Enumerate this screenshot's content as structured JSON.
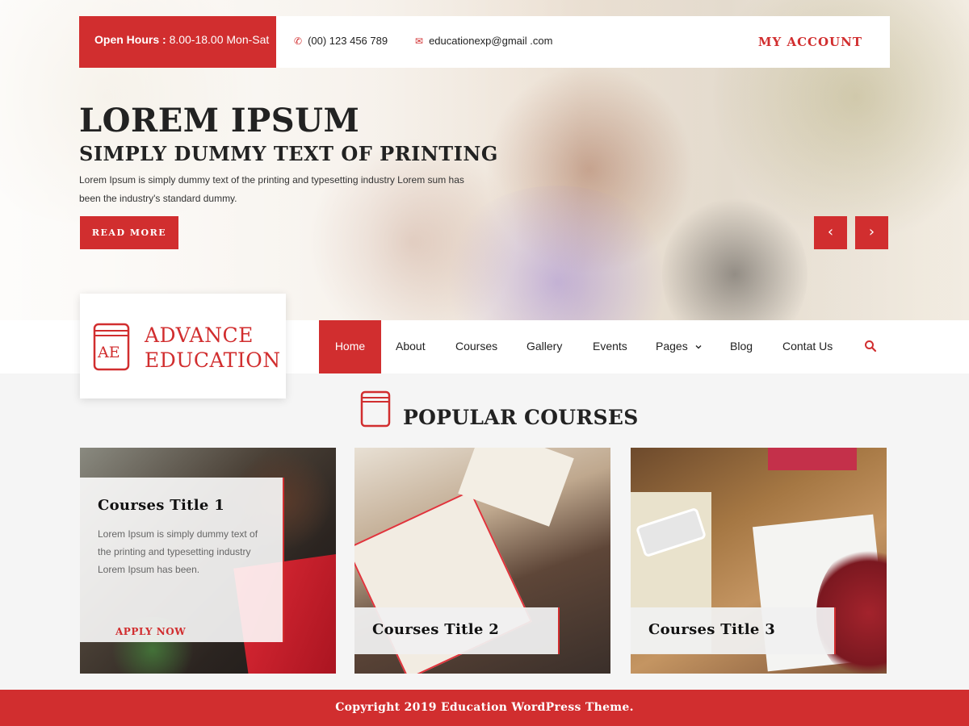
{
  "colors": {
    "accent": "#d12e2f",
    "nav_bg": "#ffffff",
    "page_bg": "#f5f5f5"
  },
  "topbar": {
    "open_hours_label": "Open Hours :",
    "open_hours_value": "8.00-18.00 Mon-Sat",
    "phone": "(00) 123 456 789",
    "phone_icon": "phone-icon",
    "email": "educationexp@gmail .com",
    "email_icon": "envelope-icon",
    "my_account": "MY ACCOUNT"
  },
  "slider": {
    "title": "LOREM IPSUM",
    "subtitle": "SIMPLY DUMMY TEXT OF PRINTING",
    "text": "Lorem Ipsum is simply dummy text of the printing and typesetting industry Lorem sum has been the industry's standard dummy.",
    "button": "READ MORE",
    "prev_icon": "chevron-left-icon",
    "next_icon": "chevron-right-icon"
  },
  "logo": {
    "icon_text": "AE",
    "line1": "ADVANCE",
    "line2": "EDUCATION"
  },
  "nav": {
    "items": [
      {
        "label": "Home",
        "active": true
      },
      {
        "label": "About"
      },
      {
        "label": "Courses"
      },
      {
        "label": "Gallery"
      },
      {
        "label": "Events"
      },
      {
        "label": "Pages",
        "dropdown": true
      },
      {
        "label": "Blog"
      },
      {
        "label": "Contat Us"
      }
    ],
    "search_icon": "search-icon"
  },
  "section": {
    "title": "POPULAR COURSES",
    "icon": "book-icon"
  },
  "courses": [
    {
      "title": "Courses Title 1",
      "desc": "Lorem Ipsum is simply dummy text of the printing and typesetting industry Lorem Ipsum has been.",
      "button": "APPLY NOW"
    },
    {
      "title": "Courses Title 2"
    },
    {
      "title": "Courses Title 3"
    }
  ],
  "footer": {
    "copyright": "Copyright 2019 Education WordPress Theme."
  }
}
